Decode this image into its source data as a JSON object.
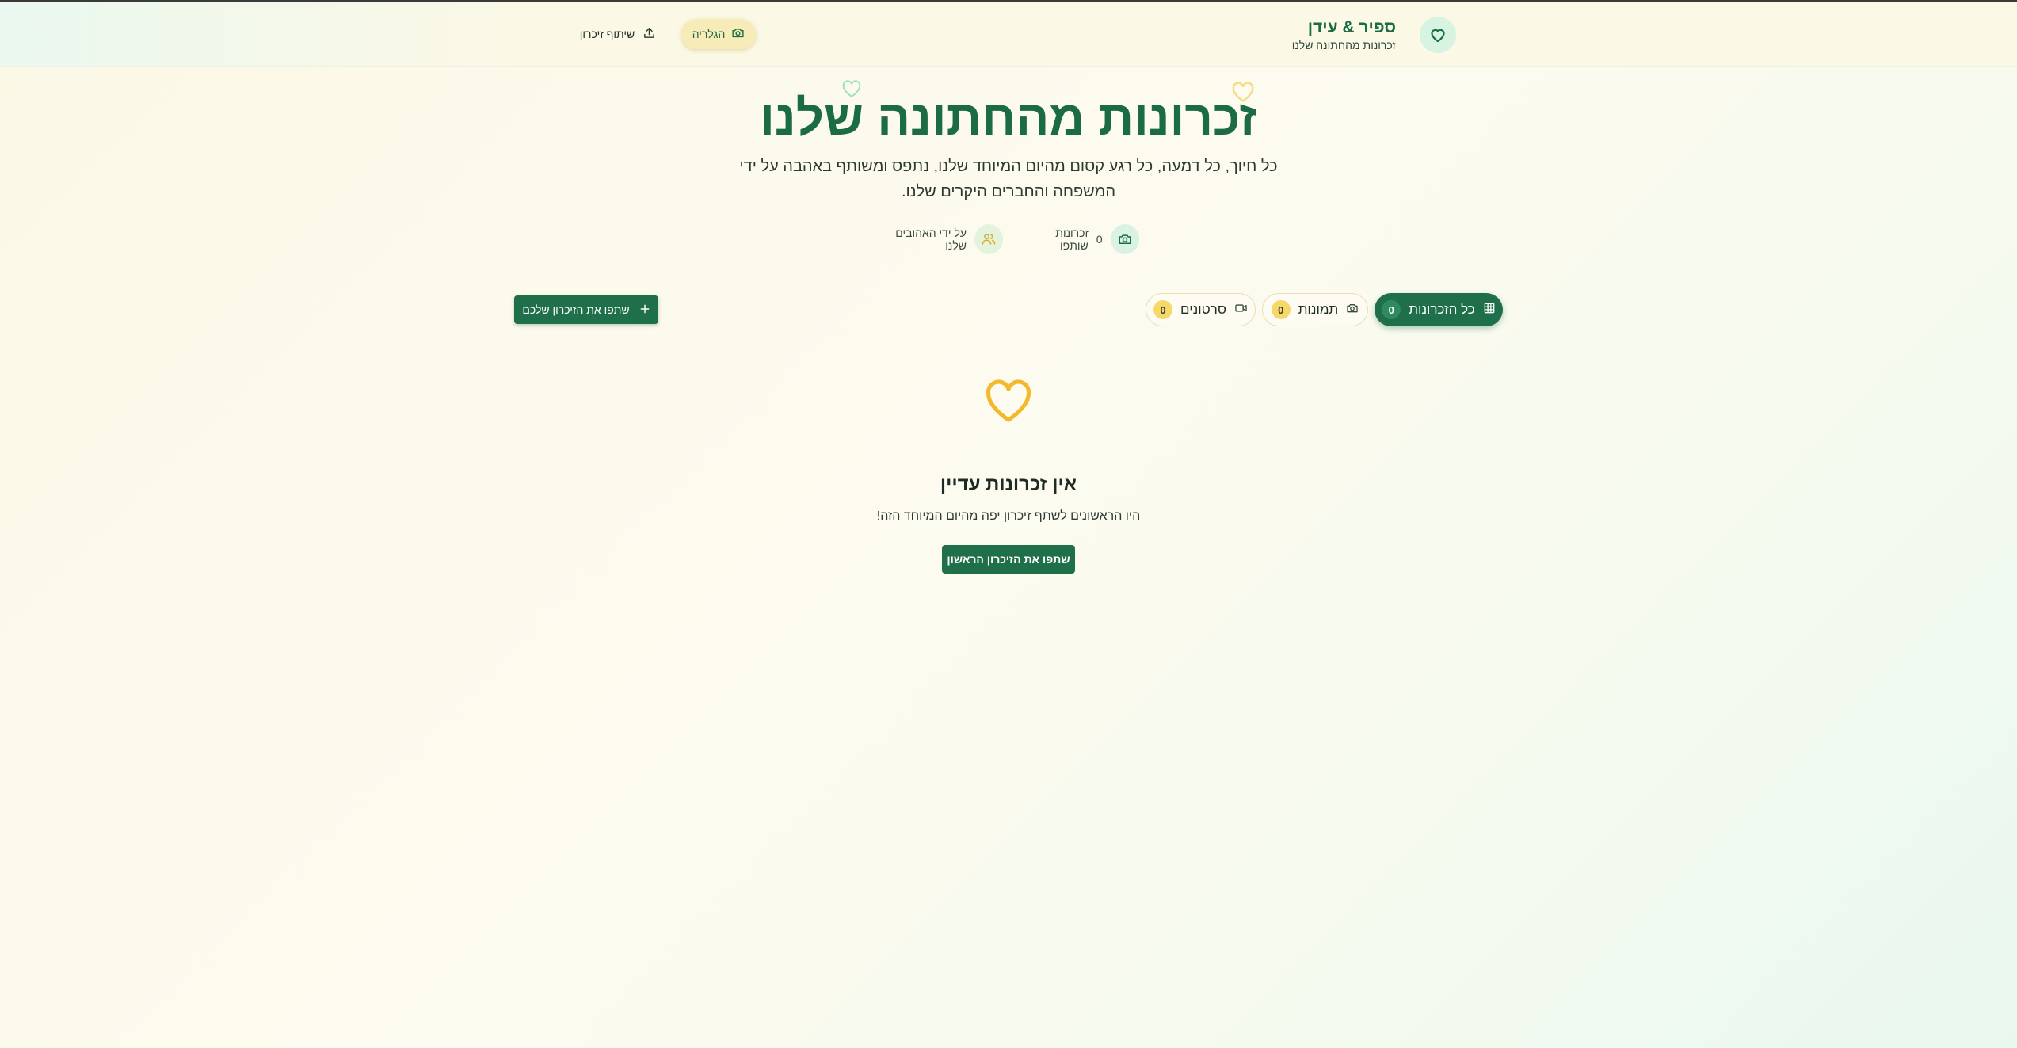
{
  "header": {
    "brand_name": "ספיר & עידן",
    "brand_subtitle": "זכרונות מהחתונה שלנו",
    "nav": {
      "gallery_label": "הגלריה",
      "share_label": "שיתוף זיכרון"
    }
  },
  "hero": {
    "title": "זכרונות מהחתונה שלנו",
    "subtitle": "כל חיוך, כל דמעה, כל רגע קסום מהיום המיוחד שלנו, נתפס ומשותף באהבה על ידי המשפחה והחברים היקרים שלנו.",
    "stats": {
      "memories_count": "0",
      "memories_label": "זכרונות שותפו",
      "by_label": "על ידי האהובים שלנו"
    }
  },
  "filters": {
    "all": {
      "label": "כל הזכרונות",
      "count": "0"
    },
    "photos": {
      "label": "תמונות",
      "count": "0"
    },
    "videos": {
      "label": "סרטונים",
      "count": "0"
    }
  },
  "share_button_label": "שתפו את הזיכרון שלכם",
  "empty_state": {
    "title": "אין זכרונות עדיין",
    "subtitle": "היו הראשונים לשתף זיכרון יפה מהיום המיוחד הזה!",
    "button_label": "שתפו את הזיכרון הראשון"
  },
  "colors": {
    "primary_green": "#1f6f4a",
    "accent_gold": "#f2b92c",
    "background": "#fbf8e6"
  },
  "icons": {
    "brand": "heart-icon",
    "gallery": "camera-icon",
    "share": "upload-icon",
    "stat_memories": "camera-icon",
    "stat_people": "users-icon",
    "filter_all": "grid-icon",
    "filter_photos": "camera-icon",
    "filter_videos": "video-icon",
    "share_button": "plus-icon",
    "empty": "heart-icon"
  }
}
